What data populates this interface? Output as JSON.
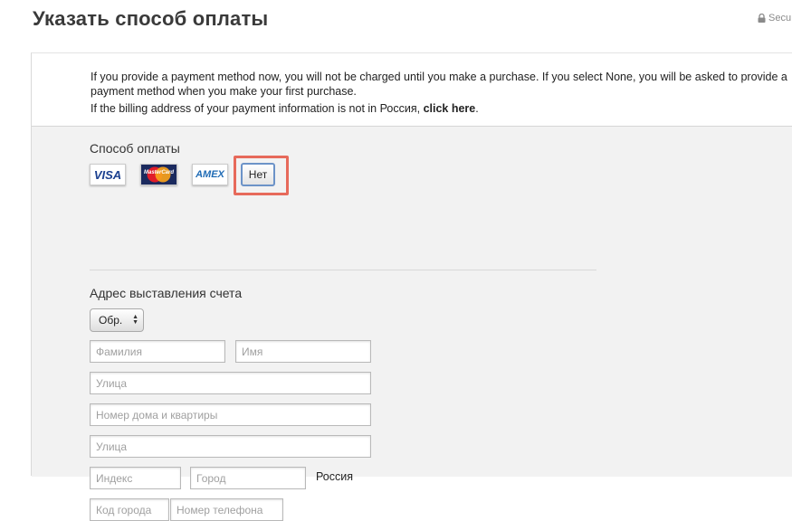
{
  "header": {
    "title": "Указать способ оплаты",
    "secure_label": "Secu"
  },
  "info": {
    "line1": "If you provide a payment method now, you will not be charged until you make a purchase. If you select None, you will be asked to provide a payment method when you make your first purchase.",
    "line2_prefix": "If the billing address of your payment information is not in Россия, ",
    "line2_link": "click here",
    "line2_suffix": "."
  },
  "payment": {
    "label": "Способ оплаты",
    "cards": [
      {
        "name": "VISA",
        "icon": "visa-card-icon"
      },
      {
        "name": "MasterCard",
        "icon": "mastercard-card-icon"
      },
      {
        "name": "AMEX",
        "icon": "amex-card-icon"
      }
    ],
    "none_label": "Нет"
  },
  "billing": {
    "label": "Адрес выставления счета",
    "salutation_selected": "Обр.",
    "placeholders": {
      "last_name": "Фамилия",
      "first_name": "Имя",
      "street1": "Улица",
      "house": "Номер дома и квартиры",
      "street2": "Улица",
      "postcode": "Индекс",
      "city": "Город",
      "area_code": "Код города",
      "phone": "Номер телефона"
    },
    "country": "Россия"
  },
  "colors": {
    "highlight": "#e76a5b",
    "form_bg": "#f2f2f2",
    "button_border": "#6c93c8"
  }
}
